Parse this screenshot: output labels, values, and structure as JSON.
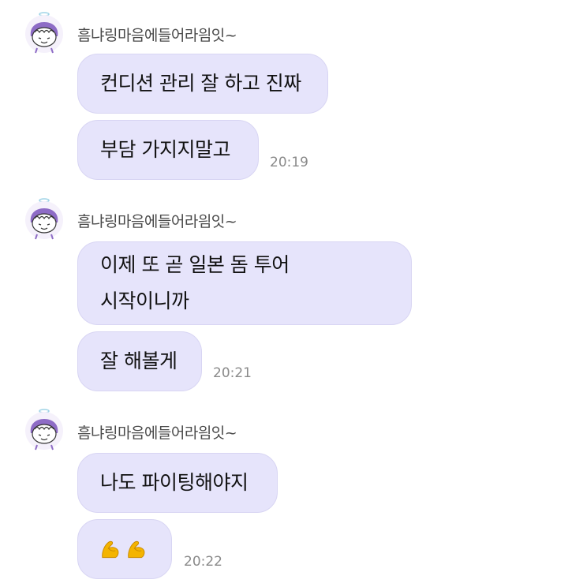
{
  "colors": {
    "bubble": "#e6e4fb",
    "bubble_border": "#d8d5f3",
    "time": "#8a8a8a",
    "sender": "#4a4a4a",
    "avatar_accent": "#8e6cc6"
  },
  "groups": [
    {
      "sender": "흠냐링마음에들어라읨잇~",
      "avatar_icon": "cartoon-face-avatar-icon",
      "messages": [
        {
          "text": "컨디션 관리 잘 하고 진짜"
        },
        {
          "text": "부담 가지지말고",
          "time": "20:19"
        }
      ]
    },
    {
      "sender": "흠냐링마음에들어라읨잇~",
      "avatar_icon": "cartoon-face-avatar-icon",
      "messages": [
        {
          "line1": "이제 또 곧 일본 돔 투어",
          "line2": "시작이니까"
        },
        {
          "text": "잘 해볼게",
          "time": "20:21"
        }
      ]
    },
    {
      "sender": "흠냐링마음에들어라읨잇~",
      "avatar_icon": "cartoon-face-avatar-icon",
      "messages": [
        {
          "text": "나도 파이팅해야지"
        },
        {
          "emoji": "flexed-biceps-icon x2",
          "time": "20:22"
        }
      ]
    }
  ]
}
